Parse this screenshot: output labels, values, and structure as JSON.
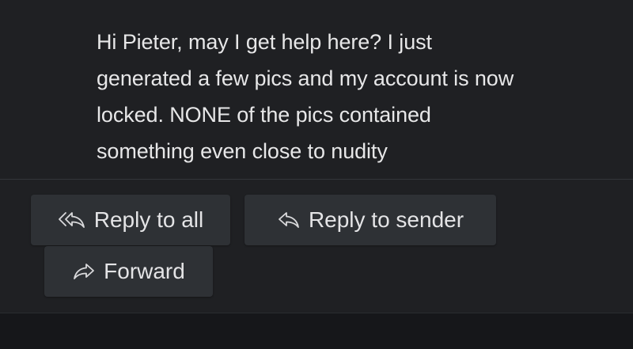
{
  "message": {
    "body_lines": [
      "Hi Pieter, may I get help here? I just",
      "generated a few pics and my account is now",
      "locked. NONE of the pics contained",
      "something even close to nudity"
    ]
  },
  "actions": {
    "reply_all": {
      "label": "Reply to all",
      "icon": "reply-all-icon"
    },
    "reply_sender": {
      "label": "Reply to sender",
      "icon": "reply-icon"
    },
    "forward": {
      "label": "Forward",
      "icon": "forward-icon"
    }
  },
  "colors": {
    "background": "#1f2023",
    "button_bg": "#2e3135",
    "text": "#e7e7e8"
  }
}
